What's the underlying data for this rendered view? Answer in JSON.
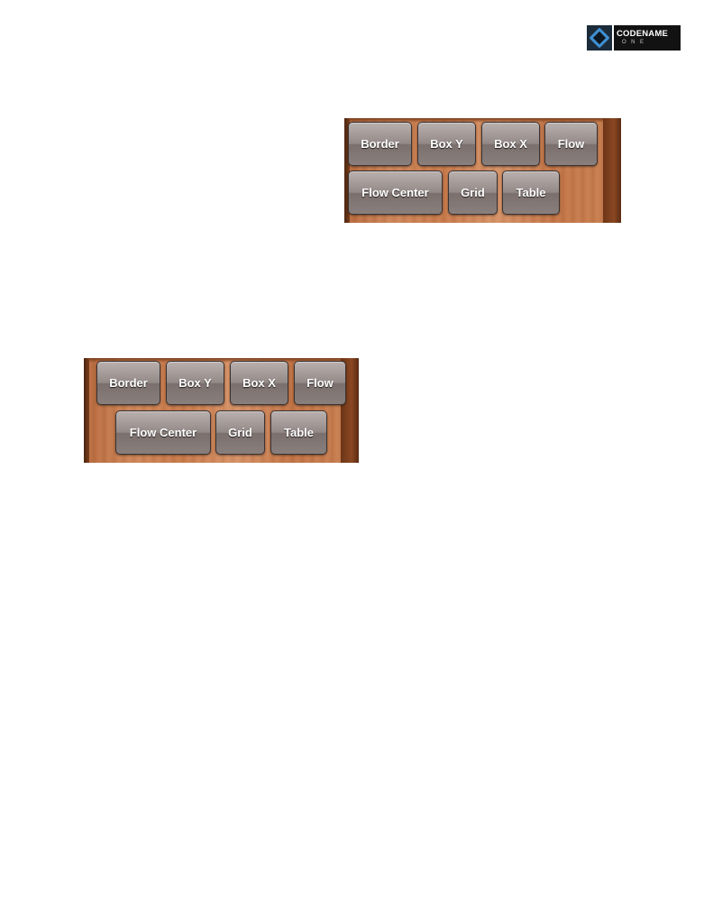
{
  "logo": {
    "name": "CODENAME",
    "sub": "ONE"
  },
  "panels": [
    {
      "row1": [
        "Border",
        "Box Y",
        "Box X",
        "Flow"
      ],
      "row2": [
        "Flow Center",
        "Grid",
        "Table"
      ]
    },
    {
      "row1": [
        "Border",
        "Box Y",
        "Box X",
        "Flow"
      ],
      "row2": [
        "Flow Center",
        "Grid",
        "Table"
      ]
    }
  ]
}
